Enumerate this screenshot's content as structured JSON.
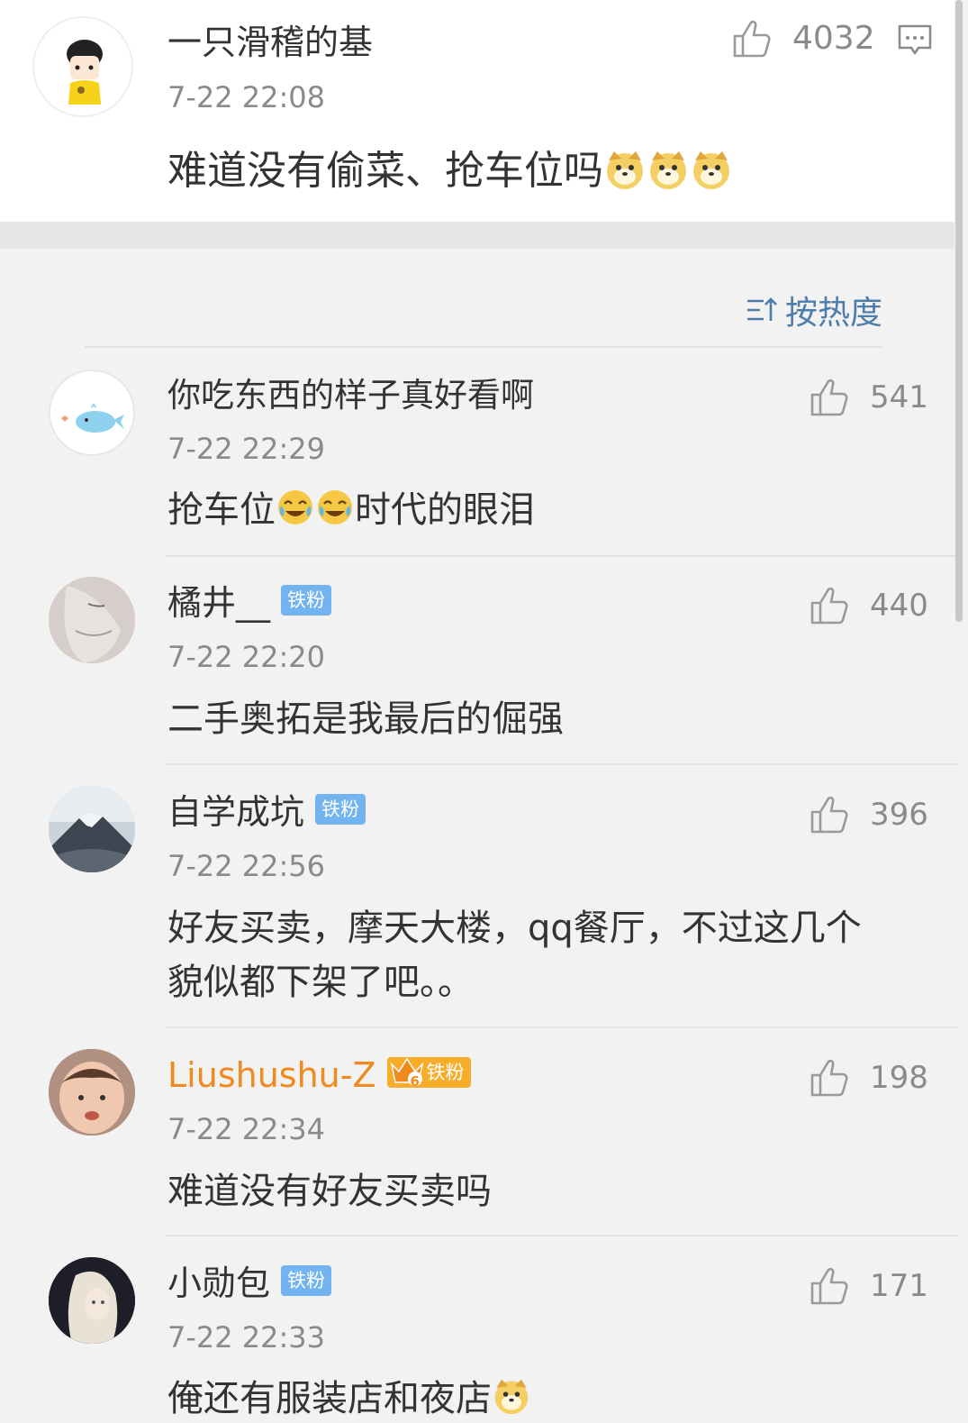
{
  "top_comment": {
    "username": "一只滑稽的基",
    "time": "7-22 22:08",
    "text": "难道没有偷菜、抢车位吗",
    "likes": "4032",
    "emoji": [
      "doge-emoji",
      "doge-emoji",
      "doge-emoji"
    ]
  },
  "sort": {
    "label": "按热度"
  },
  "comments": [
    {
      "username": "你吃东西的样子真好看啊",
      "time": "7-22 22:29",
      "text_before": "抢车位",
      "text_after": "时代的眼泪",
      "likes": "541",
      "emoji": [
        "laugh-cry-emoji",
        "laugh-cry-emoji"
      ]
    },
    {
      "username": "橘井__",
      "badge": "铁粉",
      "time": "7-22 22:20",
      "text": "二手奥拓是我最后的倔强",
      "likes": "440"
    },
    {
      "username": "自学成坑",
      "badge": "铁粉",
      "time": "7-22 22:56",
      "text_line1": "好友买卖，摩天大楼，qq餐厅，不过这几个",
      "text_line2": "貌似都下架了吧。。",
      "likes": "396"
    },
    {
      "username": "Liushushu-Z",
      "badge": "铁粉",
      "badge_level": "6",
      "time": "7-22 22:34",
      "text": "难道没有好友买卖吗",
      "likes": "198"
    },
    {
      "username": "小勋包",
      "badge": "铁粉",
      "time": "7-22 22:33",
      "text": "俺还有服装店和夜店",
      "likes": "171",
      "emoji": [
        "doge-emoji"
      ]
    }
  ],
  "colors": {
    "vip_name": "#f08a1e",
    "badge_blue": "#73b3ef",
    "badge_gold": "#f5ad2a",
    "sort_blue": "#4f7dab"
  }
}
